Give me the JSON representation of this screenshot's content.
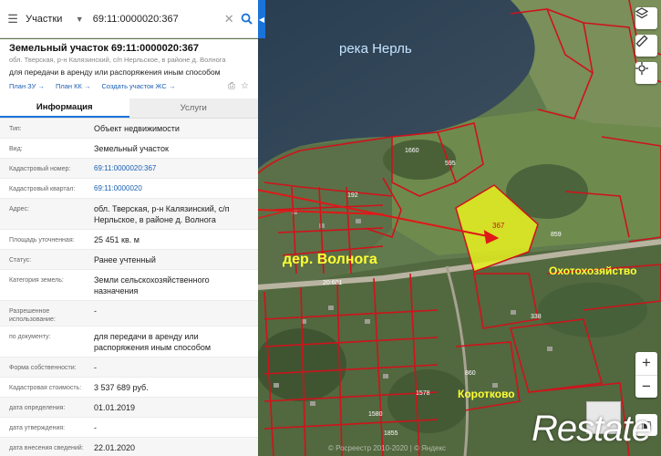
{
  "search": {
    "category": "Участки",
    "query": "69:11:0000020:367"
  },
  "parcel": {
    "title": "Земельный участок 69:11:0000020:367",
    "subtitle": "обл. Тверская, р-н Калязинский, с/п Нерльское, в районе д. Волнога",
    "purpose": "для передачи в аренду или распоряжения иным способом",
    "links": [
      "План ЗУ →",
      "План КК →",
      "Создать участок ЖС →"
    ]
  },
  "tabs": {
    "info": "Информация",
    "services": "Услуги"
  },
  "rows": [
    {
      "label": "Тип:",
      "value": "Объект недвижимости",
      "link": false
    },
    {
      "label": "Вид:",
      "value": "Земельный участок",
      "link": false
    },
    {
      "label": "Кадастровый номер:",
      "value": "69:11:0000020:367",
      "link": true
    },
    {
      "label": "Кадастровый квартал:",
      "value": "69:11:0000020",
      "link": true
    },
    {
      "label": "Адрес:",
      "value": "обл. Тверская, р-н Калязинский, с/п Нерльское, в районе д. Волнога",
      "link": false
    },
    {
      "label": "Площадь уточненная:",
      "value": "25 451 кв. м",
      "link": false
    },
    {
      "label": "Статус:",
      "value": "Ранее учтенный",
      "link": false
    },
    {
      "label": "Категория земель:",
      "value": "Земли сельскохозяйственного назначения",
      "link": false
    },
    {
      "label": "Разрешенное использование:",
      "value": "-",
      "link": false
    },
    {
      "label": "по документу:",
      "value": "для передачи в аренду или распоряжения иным способом",
      "link": false
    },
    {
      "label": "Форма собственности:",
      "value": "-",
      "link": false
    },
    {
      "label": "Кадастровая стоимость:",
      "value": "3 537 689 руб.",
      "link": false
    },
    {
      "label": "дата определения:",
      "value": "01.01.2019",
      "link": false
    },
    {
      "label": "дата утверждения:",
      "value": "-",
      "link": false
    },
    {
      "label": "дата внесения сведений:",
      "value": "22.01.2020",
      "link": false
    }
  ],
  "map": {
    "labels": {
      "river": "река Нерль",
      "village": "дер. Волнога",
      "hunting": "Охотохозяйство",
      "korotkovo": "Коротково"
    },
    "parcel_numbers": [
      "367",
      "1660",
      "595",
      "192",
      "20:601",
      "1578",
      "338",
      "860",
      "1855",
      "1580",
      "859"
    ],
    "attribution": "© Росреестр 2010-2020 | © Яндекс"
  },
  "watermark": "Restate",
  "colors": {
    "accent": "#1a73d9",
    "parcel_fill": "#e6f020",
    "boundary": "#d0121b"
  }
}
